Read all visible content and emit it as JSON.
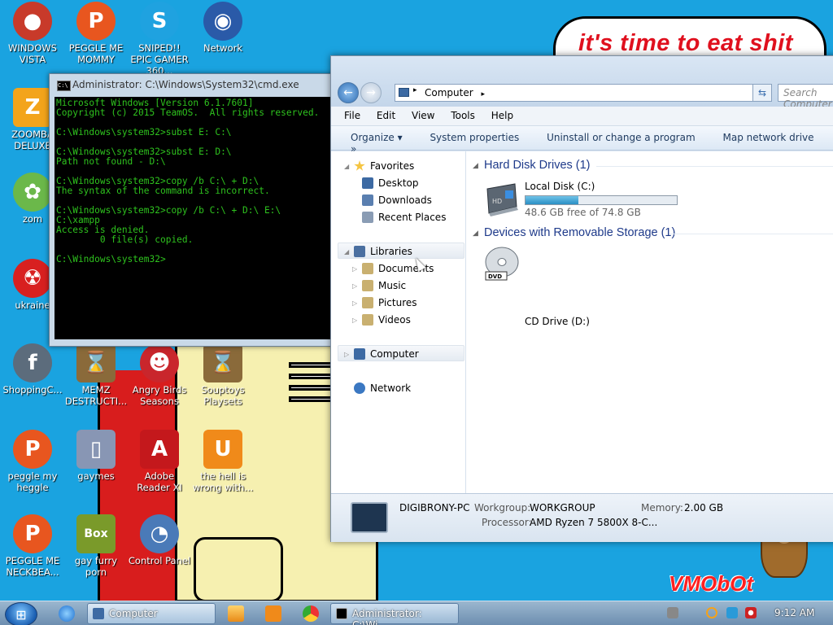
{
  "wallpaper": {
    "speech": "it's time to eat shit",
    "brand": "VMObOt"
  },
  "desktop_icons": [
    {
      "label": "WINDOWS VISTA",
      "color": "#c83a2a",
      "glyph": "●"
    },
    {
      "label": "PEGGLE ME MOMMY",
      "color": "#e8561f",
      "glyph": "P"
    },
    {
      "label": "SNIPED!! EPIC GAMER 360...",
      "color": "#1fa2e0",
      "glyph": "S"
    },
    {
      "label": "Network",
      "color": "#2a5aa8",
      "glyph": "◉"
    },
    {
      "label": "ZOOMBA DELUXE",
      "color": "#f3a41b",
      "glyph": "Z"
    },
    {
      "label": "zom",
      "color": "#6bb84a",
      "glyph": "✿"
    },
    {
      "label": "ukraine",
      "color": "#d82020",
      "glyph": "☢"
    },
    {
      "label": "ShoppingC...",
      "color": "#5c6c7c",
      "glyph": "f"
    },
    {
      "label": "MEMZ DESTRUCTI...",
      "color": "#8a6a3a",
      "glyph": "⌛"
    },
    {
      "label": "Angry Birds Seasons",
      "color": "#c9262c",
      "glyph": "☻"
    },
    {
      "label": "Souptoys Playsets",
      "color": "#8a6a3a",
      "glyph": "⌛"
    },
    {
      "label": "peggle my heggle",
      "color": "#e8561f",
      "glyph": "P"
    },
    {
      "label": "gaymes",
      "color": "#8896b4",
      "glyph": "▯"
    },
    {
      "label": "Adobe Reader XI",
      "color": "#c4181c",
      "glyph": "A"
    },
    {
      "label": "the hell is wrong with...",
      "color": "#f08a1a",
      "glyph": "U"
    },
    {
      "label": "PEGGLE ME NECKBEA...",
      "color": "#e8561f",
      "glyph": "P"
    },
    {
      "label": "gay furry porn",
      "color": "#7a9a2a",
      "glyph": "Box"
    },
    {
      "label": "Control Panel",
      "color": "#4a7ab8",
      "glyph": "◔"
    }
  ],
  "cmd": {
    "title": "Administrator: C:\\Windows\\System32\\cmd.exe",
    "lines": [
      "Microsoft Windows [Version 6.1.7601]",
      "Copyright (c) 2015 TeamOS.  All rights reserved.",
      "",
      "C:\\Windows\\system32>subst E: C:\\",
      "",
      "C:\\Windows\\system32>subst E: D:\\",
      "Path not found - D:\\",
      "",
      "C:\\Windows\\system32>copy /b C:\\ + D:\\",
      "The syntax of the command is incorrect.",
      "",
      "C:\\Windows\\system32>copy /b C:\\ + D:\\ E:\\",
      "C:\\xampp",
      "Access is denied.",
      "        0 file(s) copied.",
      "",
      "C:\\Windows\\system32>"
    ]
  },
  "explorer": {
    "breadcrumb": "Computer",
    "search_placeholder": "Search Computer",
    "menu": [
      "File",
      "Edit",
      "View",
      "Tools",
      "Help"
    ],
    "commands": [
      "Organize ▾",
      "System properties",
      "Uninstall or change a program",
      "Map network drive",
      "»"
    ],
    "nav": {
      "favorites": "Favorites",
      "desktop": "Desktop",
      "downloads": "Downloads",
      "recent": "Recent Places",
      "libraries": "Libraries",
      "documents": "Documents",
      "music": "Music",
      "pictures": "Pictures",
      "videos": "Videos",
      "computer": "Computer",
      "network": "Network"
    },
    "groups": {
      "hdd": "Hard Disk Drives (1)",
      "removable": "Devices with Removable Storage (1)"
    },
    "local_disk": {
      "name": "Local Disk (C:)",
      "free": "48.6 GB free of 74.8 GB",
      "used_fraction": 0.35
    },
    "cd_drive": {
      "name": "CD Drive (D:)"
    },
    "details": {
      "pc_name": "DIGIBRONY-PC",
      "workgroup_label": "Workgroup:",
      "workgroup": "WORKGROUP",
      "memory_label": "Memory:",
      "memory": "2.00 GB",
      "processor_label": "Processor:",
      "processor": "AMD Ryzen 7 5800X 8-C..."
    }
  },
  "taskbar": {
    "explorer_btn": "Computer",
    "cmd_btn": "Administrator: C:\\Wi...",
    "clock": "9:12 AM"
  }
}
